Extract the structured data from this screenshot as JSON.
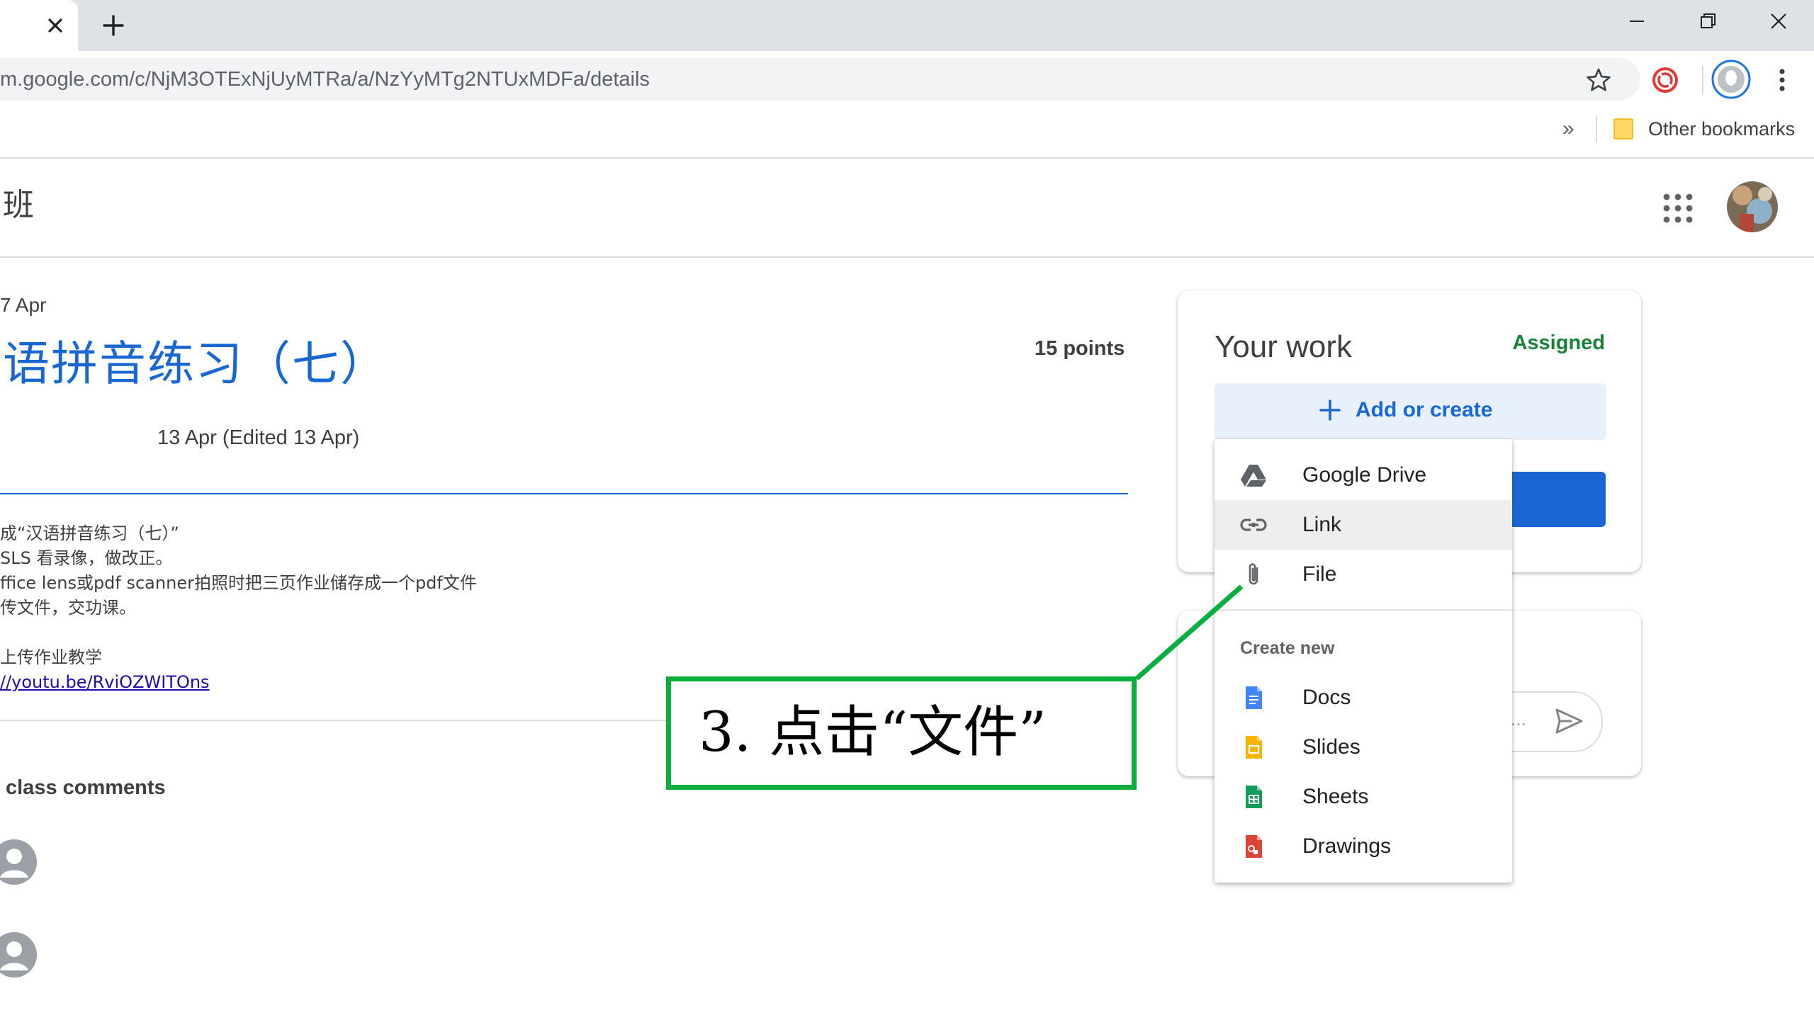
{
  "browser": {
    "url": "m.google.com/c/NjM3OTExNjUyMTRa/a/NzYyMTg2NTUxMDFa/details",
    "bookmarks_overflow": "»",
    "other_bookmarks": "Other bookmarks"
  },
  "header": {
    "class_name": "班"
  },
  "assignment": {
    "due": "7 Apr",
    "title": "语拼音练习（七）",
    "points": "15 points",
    "posted": "13 Apr (Edited 13 Apr)",
    "description_lines": [
      "成“汉语拼音练习（七）”",
      "SLS 看录像，做改正。",
      "ffice lens或pdf scanner拍照时把三页作业储存成一个pdf文件",
      "传文件，交功课。",
      "",
      "上传作业教学"
    ],
    "link": "//youtu.be/RviOZWITOns"
  },
  "comments": {
    "title": "class comments",
    "placeholder": "..."
  },
  "your_work": {
    "title": "Your work",
    "status": "Assigned",
    "add_label": "Add or create"
  },
  "menu": {
    "items": [
      {
        "label": "Google Drive",
        "icon": "google-drive-icon"
      },
      {
        "label": "Link",
        "icon": "link-icon"
      },
      {
        "label": "File",
        "icon": "paperclip-icon"
      }
    ],
    "create_new": "Create new",
    "create_items": [
      {
        "label": "Docs",
        "icon": "docs-icon",
        "color": "#4285f4"
      },
      {
        "label": "Slides",
        "icon": "slides-icon",
        "color": "#f4b400"
      },
      {
        "label": "Sheets",
        "icon": "sheets-icon",
        "color": "#0f9d58"
      },
      {
        "label": "Drawings",
        "icon": "drawings-icon",
        "color": "#db4437"
      }
    ]
  },
  "annotation": {
    "text": "3. 点击“文件”",
    "color": "#0aae3f"
  },
  "colors": {
    "accent": "#1967d2",
    "assigned": "#188038",
    "chrome_frame": "#dee1e6"
  }
}
